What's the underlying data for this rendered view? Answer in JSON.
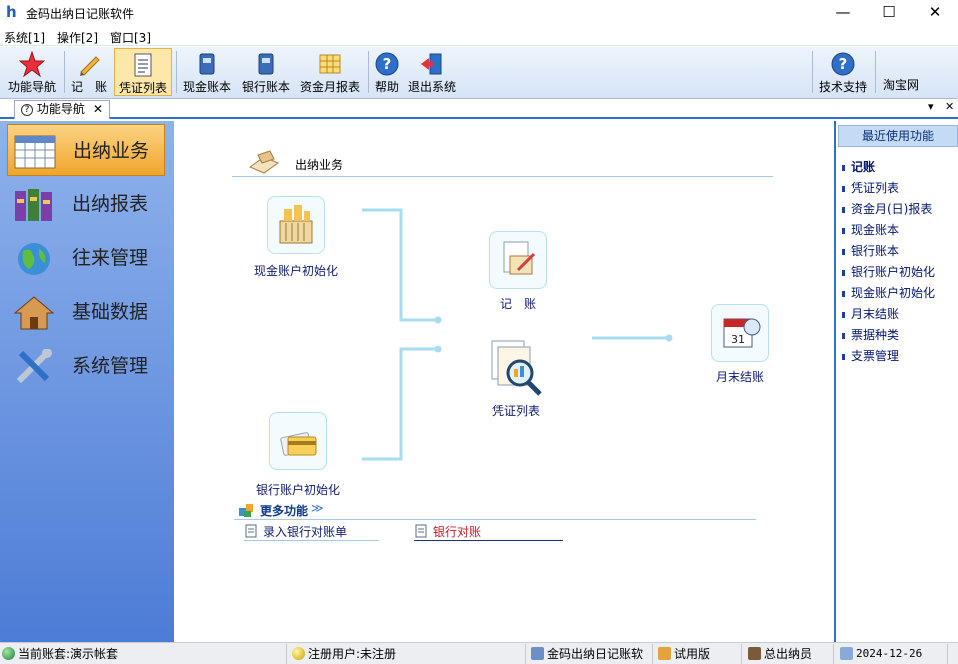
{
  "window": {
    "title": "金码出纳日记账软件",
    "min": "—",
    "max": "☐",
    "close": "✕"
  },
  "menu": [
    "系统[1]",
    "操作[2]",
    "窗口[3]"
  ],
  "toolbar": {
    "items": [
      "功能导航",
      "记　账",
      "凭证列表",
      "现金账本",
      "银行账本",
      "资金月报表",
      "帮助",
      "退出系统",
      "技术支持",
      "淘宝网"
    ],
    "active": "凭证列表"
  },
  "tab": {
    "label": "功能导航",
    "close": "✕",
    "menu_arrow": "▾",
    "close_all": "✕"
  },
  "sidebar": {
    "items": [
      "出纳业务",
      "出纳报表",
      "往来管理",
      "基础数据",
      "系统管理"
    ],
    "active": "出纳业务"
  },
  "main": {
    "section_title": "出纳业务",
    "nodes": {
      "cash_init": "现金账户初始化",
      "bookkeeping": "记　账",
      "voucher_list": "凭证列表",
      "month_end": "月末结账",
      "bank_init": "银行账户初始化"
    },
    "more_label": "更多功能",
    "more_arrows": "≫",
    "links": [
      "录入银行对账单",
      "银行对账"
    ]
  },
  "recent": {
    "title": "最近使用功能",
    "items": [
      "记账",
      "凭证列表",
      "资金月(日)报表",
      "现金账本",
      "银行账本",
      "银行账户初始化",
      "现金账户初始化",
      "月末结账",
      "票据种类",
      "支票管理"
    ]
  },
  "status": {
    "account": "当前账套:演示帐套",
    "user": "注册用户:未注册",
    "product": "金码出纳日记账软",
    "edition": "试用版",
    "operator": "总出纳员",
    "date": "2024-12-26"
  },
  "colors": {
    "accent": "#2f6fc6",
    "sidebar_top": "#8fb2ec",
    "sidebar_bottom": "#4d7cd6",
    "active_item": "#f0a52c",
    "connector": "#a8dcf0",
    "link_red": "#c0202a"
  }
}
